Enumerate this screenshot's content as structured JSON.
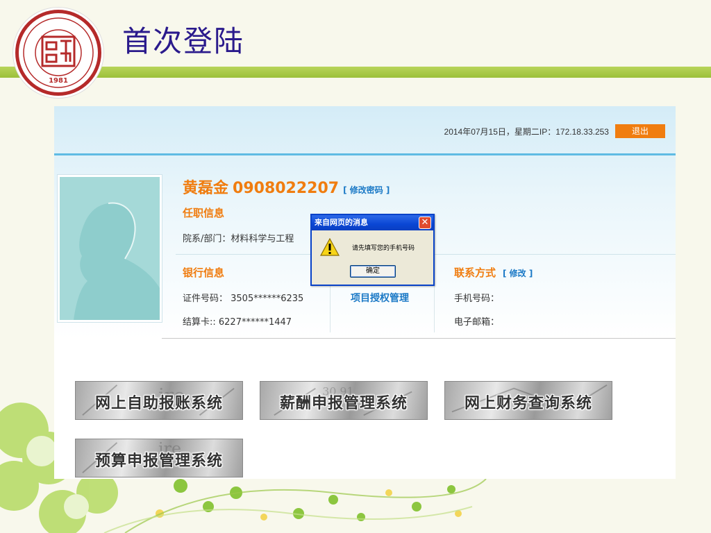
{
  "slide": {
    "title": "首次登陆",
    "logo_year": "1981"
  },
  "header": {
    "date_ip": "2014年07月15日，星期二IP：172.18.33.253",
    "logout_label": "退出"
  },
  "profile": {
    "name": "黄磊金",
    "staff_id": "0908022207",
    "change_password_label": "[ 修改密码 ]",
    "employment_title": "任职信息",
    "department_label": "院系/部门：材料科学与工程",
    "bank_title": "银行信息",
    "id_number_label": "证件号码：  3505******6235",
    "settlement_card_label": "结算卡::  6227******1447",
    "project_link": "项目授权管理",
    "contact_title": "联系方式",
    "contact_edit_label": "[ 修改 ]",
    "phone_label": "手机号码：",
    "email_label": "电子邮箱："
  },
  "systems": [
    {
      "label": "网上自助报账系统"
    },
    {
      "label": "薪酬申报管理系统"
    },
    {
      "label": "网上财务查询系统"
    },
    {
      "label": "预算申报管理系统"
    }
  ],
  "dialog": {
    "title": "来自网页的消息",
    "message": "请先填写您的手机号码",
    "ok_label": "确定",
    "close_glyph": "✕"
  },
  "colors": {
    "accent_orange": "#f07d10",
    "link_blue": "#1b79c6",
    "title_indigo": "#2a1a8c",
    "header_green": "#9cc03a"
  }
}
